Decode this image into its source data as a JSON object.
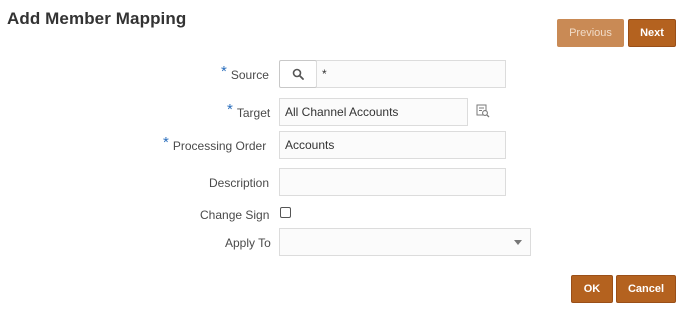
{
  "dialog": {
    "title": "Add Member Mapping"
  },
  "nav": {
    "previous_label": "Previous",
    "next_label": "Next"
  },
  "form": {
    "required_marker": "*",
    "source": {
      "label": "Source",
      "value": "*",
      "search_icon": "search-icon"
    },
    "target": {
      "label": "Target",
      "value": "All Channel Accounts",
      "lookup_icon": "member-selector-icon"
    },
    "processing_order": {
      "label": "Processing Order",
      "value": "Accounts"
    },
    "description": {
      "label": "Description",
      "value": ""
    },
    "change_sign": {
      "label": "Change Sign",
      "checked": false
    },
    "apply_to": {
      "label": "Apply To",
      "value": ""
    }
  },
  "footer": {
    "ok_label": "OK",
    "cancel_label": "Cancel"
  },
  "colors": {
    "button": "#b4621f",
    "button_disabled": "#c98a55",
    "required": "#2a6ebd"
  }
}
